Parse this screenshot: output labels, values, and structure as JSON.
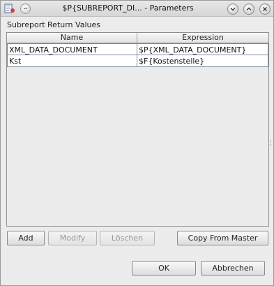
{
  "window": {
    "title": "$P{SUBREPORT_DI... - Parameters",
    "app_icon": "jasper-report-icon",
    "menu_icon": "window-menu-icon",
    "minimize_icon": "minimize-icon",
    "maximize_icon": "maximize-icon",
    "close_icon": "close-icon"
  },
  "section": {
    "label": "Subreport Return Values"
  },
  "table": {
    "columns": [
      "Name",
      "Expression"
    ],
    "rows": [
      {
        "name": "XML_DATA_DOCUMENT",
        "expression": "$P{XML_DATA_DOCUMENT}"
      },
      {
        "name": "Kst",
        "expression": "$F{Kostenstelle}"
      }
    ]
  },
  "buttons": {
    "add": "Add",
    "modify": "Modify",
    "delete": "Löschen",
    "copy_from_master": "Copy From Master",
    "ok": "OK",
    "cancel": "Abbrechen"
  },
  "colors": {
    "window_bg": "#ececec",
    "grid_line": "#7a8aa0",
    "disabled_text": "#9a9a9a"
  }
}
